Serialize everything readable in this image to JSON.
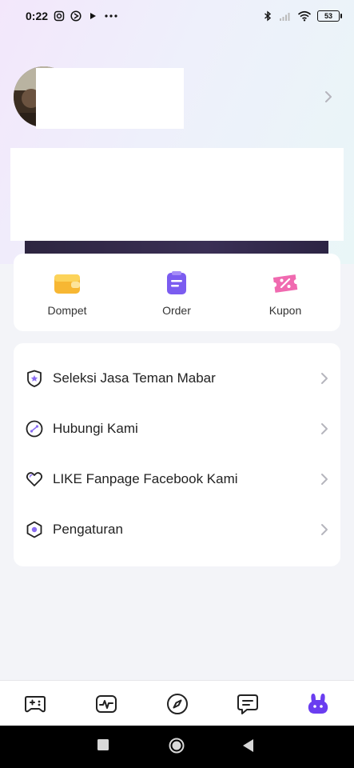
{
  "status_bar": {
    "time": "0:22",
    "battery": "53",
    "left_icons": [
      "instagram-icon",
      "media-icon",
      "play-icon",
      "more-icon"
    ],
    "right_icons": [
      "bluetooth-icon",
      "signal-icon",
      "wifi-icon",
      "battery-icon"
    ]
  },
  "profile": {
    "avatar": "avatar-photo",
    "chevron_icon": "chevron-right-icon"
  },
  "quick_actions": [
    {
      "label": "Dompet",
      "icon": "wallet-icon",
      "color": "#f7b733"
    },
    {
      "label": "Order",
      "icon": "clipboard-icon",
      "color": "#7b5cf0"
    },
    {
      "label": "Kupon",
      "icon": "coupon-icon",
      "color": "#f06ab0"
    }
  ],
  "menu": [
    {
      "label": "Seleksi Jasa Teman Mabar",
      "icon": "badge-star-icon"
    },
    {
      "label": "Hubungi Kami",
      "icon": "support-icon"
    },
    {
      "label": "LIKE Fanpage Facebook Kami",
      "icon": "heart-icon"
    },
    {
      "label": "Pengaturan",
      "icon": "settings-hex-icon"
    }
  ],
  "bottom_nav": [
    {
      "name": "games",
      "icon": "gamepad-icon",
      "active": false
    },
    {
      "name": "activity",
      "icon": "pulse-icon",
      "active": false
    },
    {
      "name": "discover",
      "icon": "compass-icon",
      "active": false
    },
    {
      "name": "messages",
      "icon": "chat-icon",
      "active": false
    },
    {
      "name": "profile",
      "icon": "bunny-icon",
      "active": true
    }
  ],
  "colors": {
    "accent": "#6a3df0",
    "text": "#222222",
    "chevron": "#b5b5bd"
  }
}
